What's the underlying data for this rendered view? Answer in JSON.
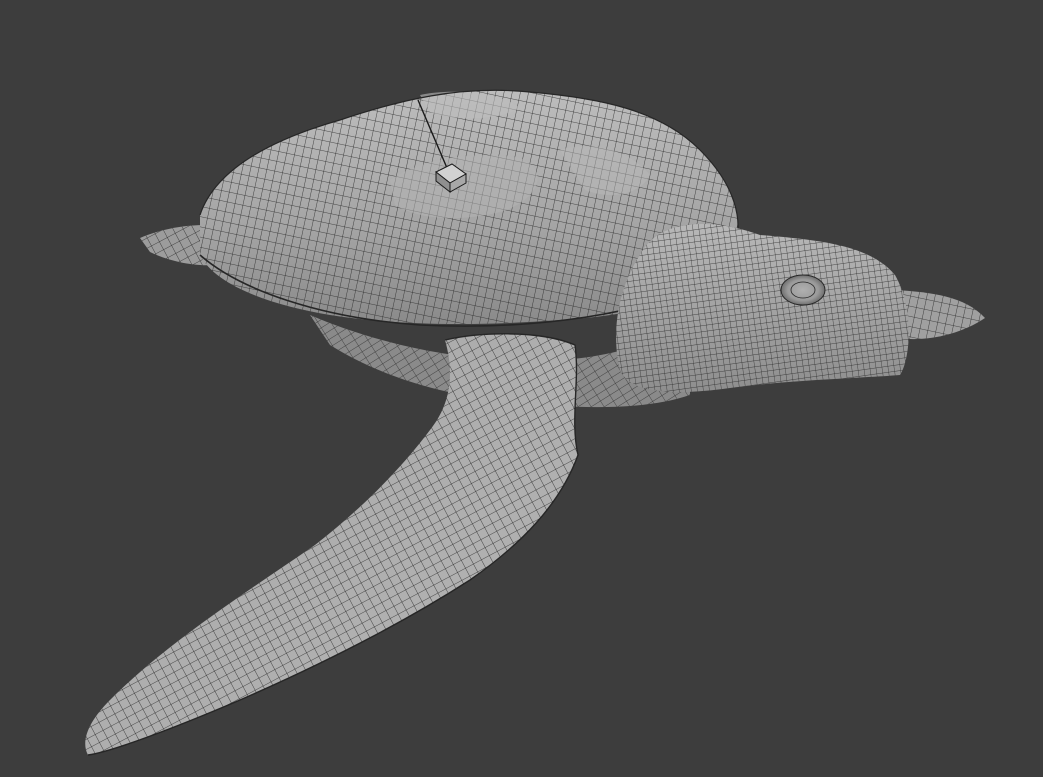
{
  "viewport": {
    "background_color": "#3d3d3d",
    "mesh_fill_color": "#a6a6a6",
    "mesh_shadow_color": "#7e7e7e",
    "mesh_highlight_color": "#c2c2c2",
    "wire_color": "#262626"
  },
  "scene": {
    "objects": [
      {
        "name": "turtle-shell",
        "type": "mesh"
      },
      {
        "name": "turtle-body",
        "type": "mesh"
      },
      {
        "name": "turtle-head",
        "type": "mesh"
      },
      {
        "name": "turtle-front-flipper",
        "type": "mesh"
      },
      {
        "name": "turtle-rear-flipper-left",
        "type": "mesh"
      },
      {
        "name": "turtle-rear-flipper-right",
        "type": "mesh"
      },
      {
        "name": "object-origin-cube",
        "type": "empty"
      }
    ]
  }
}
